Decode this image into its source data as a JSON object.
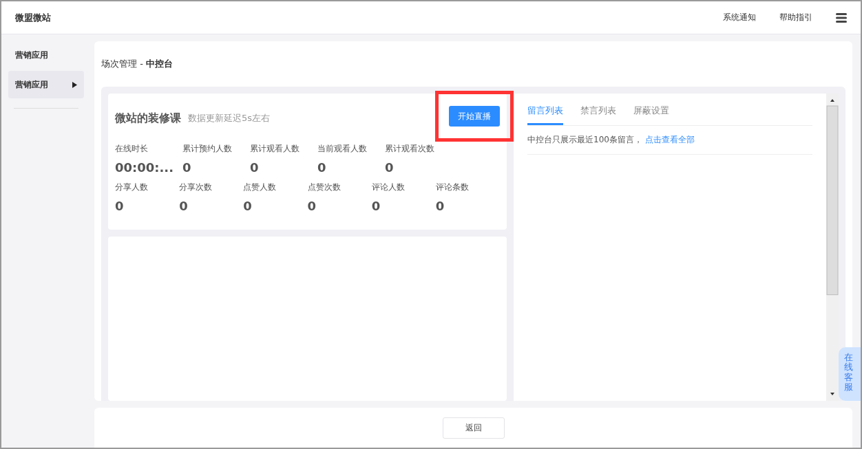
{
  "header": {
    "brand": "微盟微站",
    "links": [
      "系统通知",
      "帮助指引"
    ]
  },
  "sidebar": {
    "title": "营销应用",
    "items": [
      {
        "label": "营销应用",
        "selected": true
      }
    ]
  },
  "breadcrumb": {
    "parent": "场次管理",
    "separator": "-",
    "current": "中控台"
  },
  "course": {
    "title": "微站的装修课",
    "note": "数据更新延迟5s左右",
    "start_button": "开始直播",
    "highlighted": true
  },
  "stats": [
    [
      {
        "label": "在线时长",
        "value": "00:00:..."
      },
      {
        "label": "累计预约人数",
        "value": "0"
      },
      {
        "label": "累计观看人数",
        "value": "0"
      },
      {
        "label": "当前观看人数",
        "value": "0"
      },
      {
        "label": "累计观看次数",
        "value": "0"
      }
    ],
    [
      {
        "label": "分享人数",
        "value": "0"
      },
      {
        "label": "分享次数",
        "value": "0"
      },
      {
        "label": "点赞人数",
        "value": "0"
      },
      {
        "label": "点赞次数",
        "value": "0"
      },
      {
        "label": "评论人数",
        "value": "0"
      },
      {
        "label": "评论条数",
        "value": "0"
      }
    ]
  ],
  "comment_tabs": [
    {
      "label": "留言列表",
      "selected": true
    },
    {
      "label": "禁言列表",
      "selected": false
    },
    {
      "label": "屏蔽设置",
      "selected": false
    }
  ],
  "comment_notice": {
    "text": "中控台只展示最近100条留言，",
    "link": "点击查看全部"
  },
  "online_service": "在线客服",
  "footer": {
    "back_button": "返回"
  }
}
